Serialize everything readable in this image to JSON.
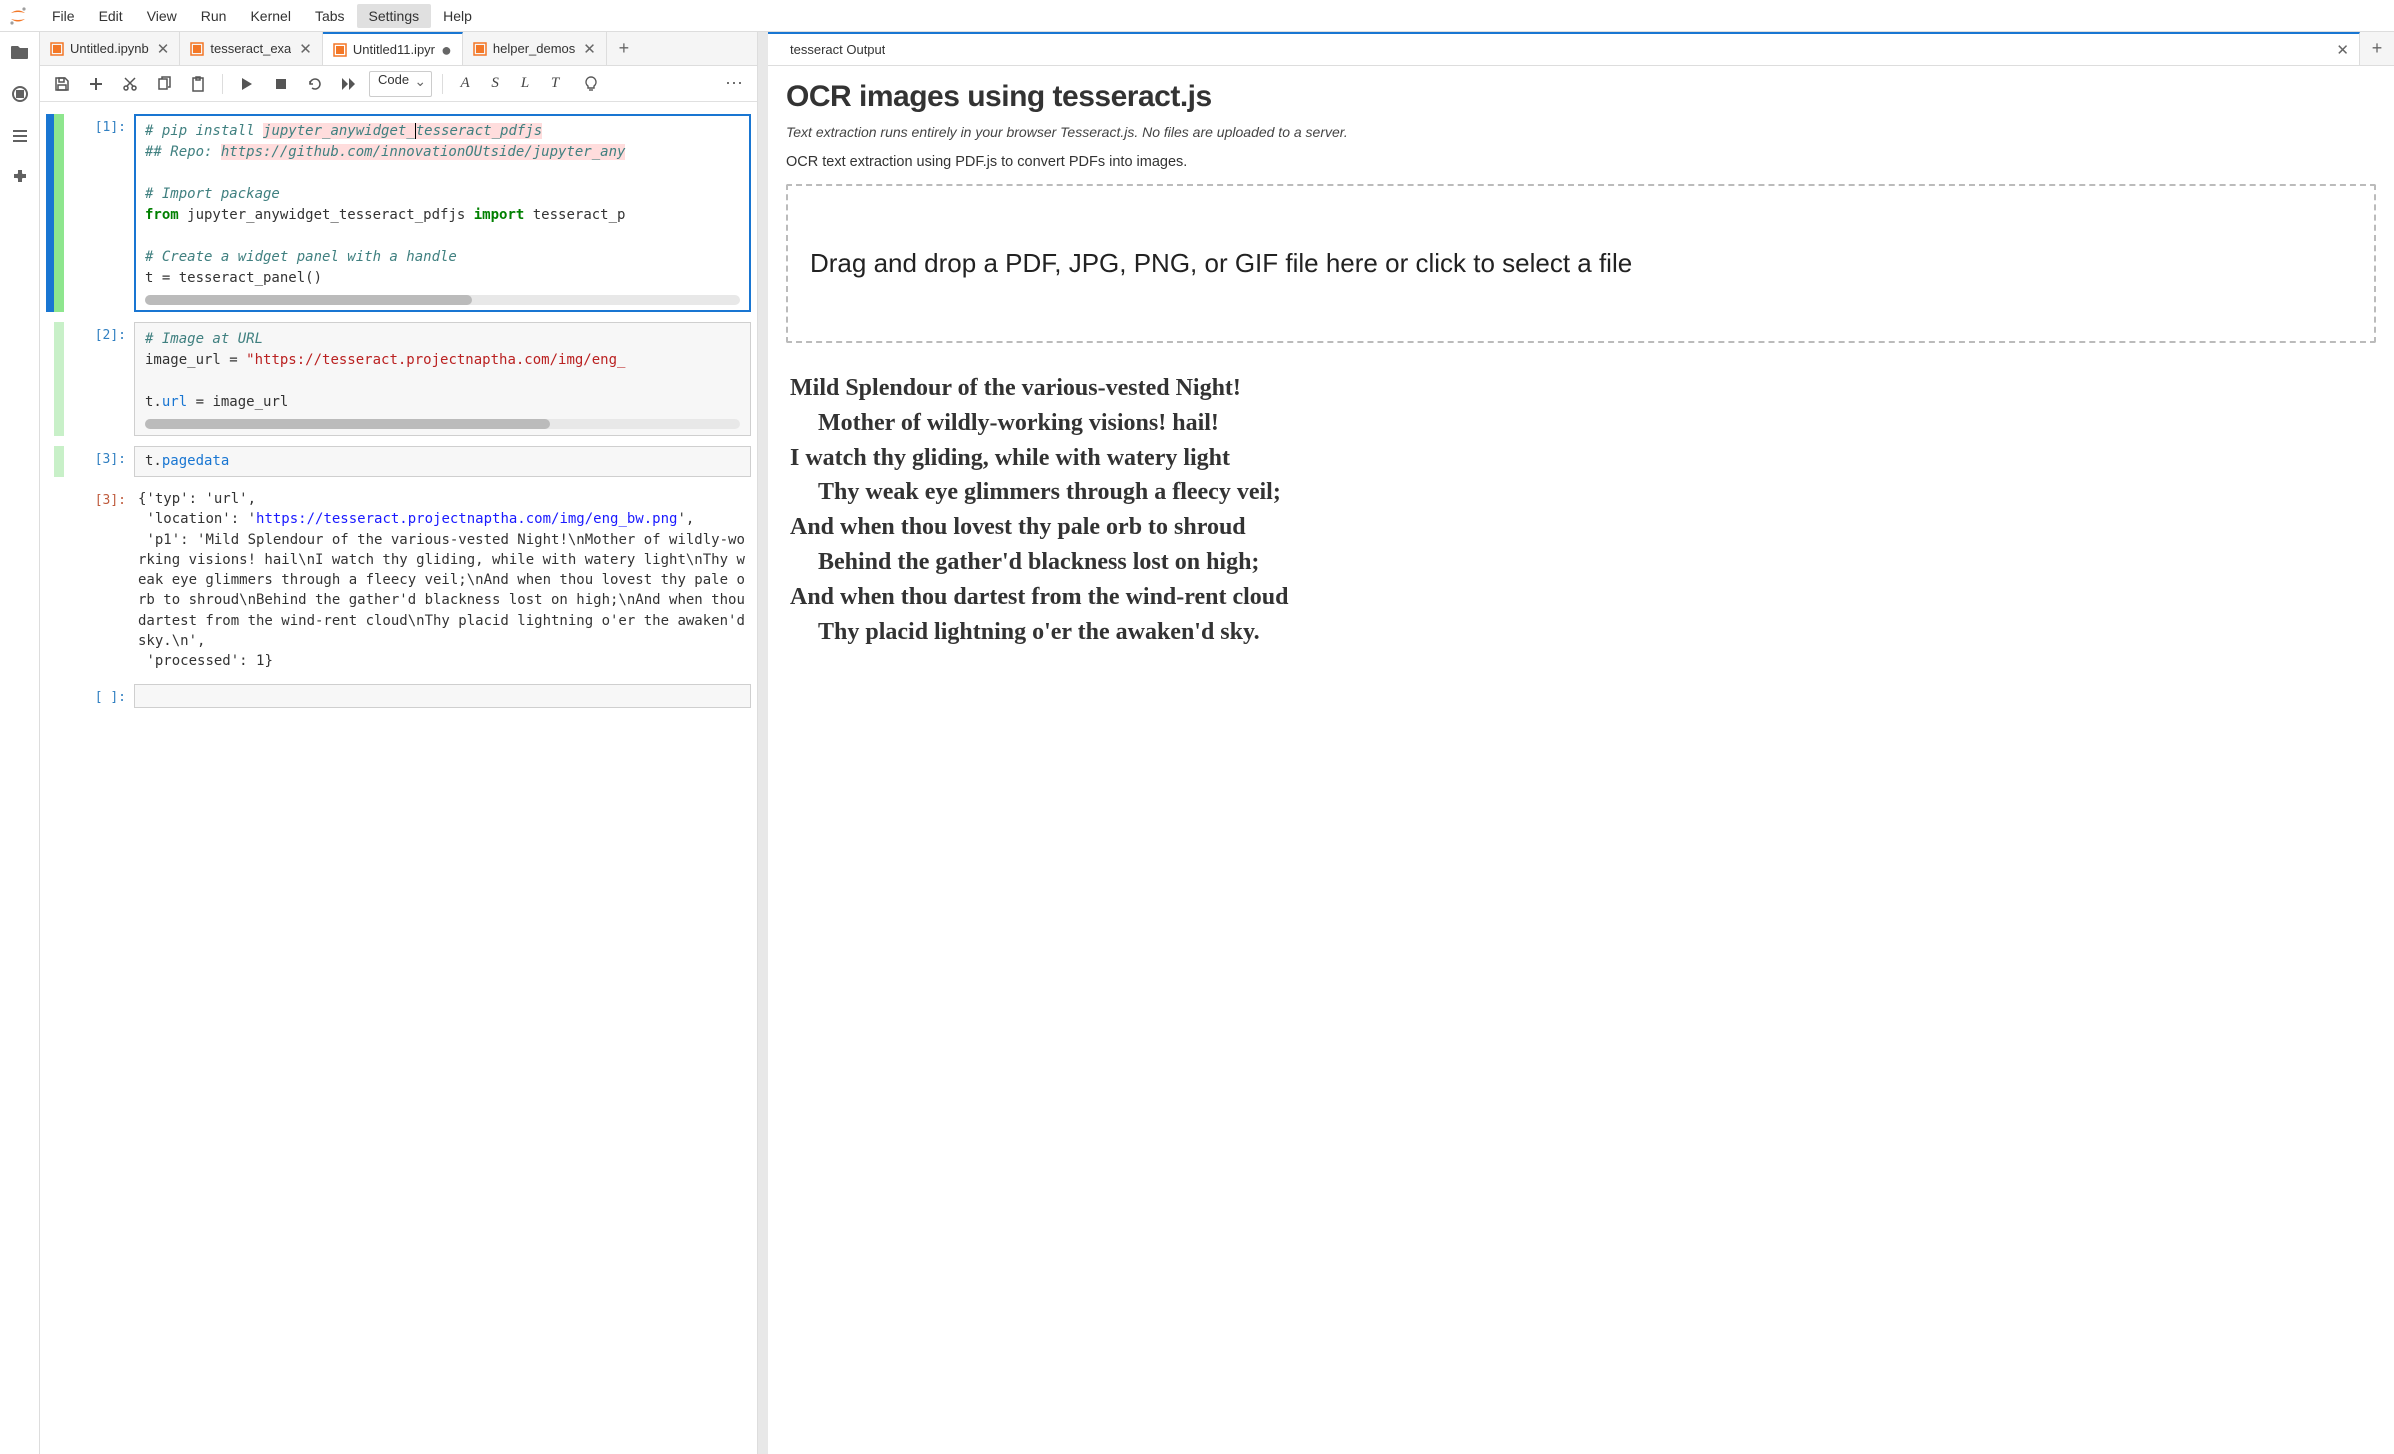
{
  "menu": [
    "File",
    "Edit",
    "View",
    "Run",
    "Kernel",
    "Tabs",
    "Settings",
    "Help"
  ],
  "active_menu": "Settings",
  "left_tabs": [
    {
      "label": "Untitled.ipynb",
      "closable": true,
      "dirty": false
    },
    {
      "label": "tesseract_exa",
      "closable": true,
      "dirty": false
    },
    {
      "label": "Untitled11.ipyr",
      "closable": false,
      "dirty": true,
      "active": true
    },
    {
      "label": "helper_demos",
      "closable": true,
      "dirty": false
    }
  ],
  "toolbar": {
    "cell_type": "Code",
    "letters": [
      "A",
      "S",
      "L",
      "T"
    ]
  },
  "cells": {
    "c1": {
      "prompt": "[1]:",
      "lines_plain": [
        "# pip install jupyter_anywidget_tesseract_pdfjs",
        "## Repo: https://github.com/innovationOUtside/jupyter_any",
        "",
        "# Import package",
        "from jupyter_anywidget_tesseract_pdfjs import tesseract_p",
        "",
        "# Create a widget panel with a handle",
        "t = tesseract_panel()"
      ],
      "scroll_thumb_pct": 55
    },
    "c2": {
      "prompt": "[2]:",
      "l1": "# Image at URL",
      "l2a": "image_url = ",
      "l2b": "\"https://tesseract.projectnaptha.com/img/eng_",
      "l3": "",
      "l4a": "t.",
      "l4b": "url",
      "l4c": " = image_url",
      "scroll_thumb_pct": 68
    },
    "c3": {
      "prompt": "[3]:",
      "code_a": "t.",
      "code_b": "pagedata"
    },
    "out3": {
      "prompt": "[3]:",
      "text": "{'typ': 'url',\n 'location': 'https://tesseract.projectnaptha.com/img/eng_bw.png',\n 'p1': 'Mild Splendour of the various-vested Night!\\nMother of wildly-working visions! hail\\nI watch thy gliding, while with watery light\\nThy weak eye glimmers through a fleecy veil;\\nAnd when thou lovest thy pale orb to shroud\\nBehind the gather'd blackness lost on high;\\nAnd when thou dartest from the wind-rent cloud\\nThy placid lightning o'er the awaken'd sky.\\n',\n 'processed': 1}"
    },
    "c4": {
      "prompt": "[ ]:"
    }
  },
  "right_tab": {
    "label": "tesseract Output"
  },
  "panel": {
    "title": "OCR images using tesseract.js",
    "subtitle": "Text extraction runs entirely in your browser Tesseract.js. No files are uploaded to a server.",
    "desc": "OCR text extraction using PDF.js to convert PDFs into images.",
    "dropzone": "Drag and drop a PDF, JPG, PNG, or GIF file here or click to select a file",
    "poem": [
      {
        "t": "Mild Splendour of the various-vested Night!",
        "i": false
      },
      {
        "t": "Mother of wildly-working visions! hail!",
        "i": true
      },
      {
        "t": "I watch thy gliding, while with watery light",
        "i": false
      },
      {
        "t": "Thy weak eye glimmers through a fleecy veil;",
        "i": true
      },
      {
        "t": "And when thou lovest thy pale orb to shroud",
        "i": false
      },
      {
        "t": "Behind the gather'd blackness lost on high;",
        "i": true
      },
      {
        "t": "And when thou dartest from the wind-rent cloud",
        "i": false
      },
      {
        "t": "Thy placid lightning o'er the awaken'd sky.",
        "i": true
      }
    ]
  }
}
